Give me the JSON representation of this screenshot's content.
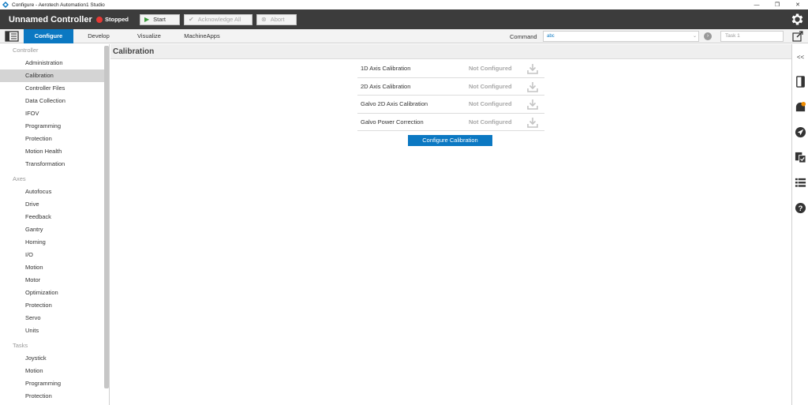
{
  "window": {
    "title": "Configure - Aerotech Automation1 Studio",
    "minimize": "—",
    "restore": "❐",
    "close": "✕"
  },
  "header": {
    "controller_name": "Unnamed Controller",
    "status": "Stopped",
    "status_color": "#e53935",
    "start_label": "Start",
    "acknowledge_label": "Acknowledge All",
    "abort_label": "Abort"
  },
  "nav": {
    "tabs": [
      {
        "label": "Configure",
        "active": true
      },
      {
        "label": "Develop",
        "active": false
      },
      {
        "label": "Visualize",
        "active": false
      },
      {
        "label": "MachineApps",
        "active": false
      }
    ],
    "command_label": "Command",
    "command_value": "abc",
    "task_placeholder": "Task 1"
  },
  "sidebar": {
    "groups": [
      {
        "label": "Controller",
        "items": [
          "Administration",
          "Calibration",
          "Controller Files",
          "Data Collection",
          "IFOV",
          "Programming",
          "Protection",
          "Motion Health",
          "Transformation"
        ]
      },
      {
        "label": "Axes",
        "items": [
          "Autofocus",
          "Drive",
          "Feedback",
          "Gantry",
          "Homing",
          "I/O",
          "Motion",
          "Motor",
          "Optimization",
          "Protection",
          "Servo",
          "Units"
        ]
      },
      {
        "label": "Tasks",
        "items": [
          "Joystick",
          "Motion",
          "Programming",
          "Protection"
        ]
      }
    ],
    "selected": "Calibration"
  },
  "main": {
    "title": "Calibration",
    "rows": [
      {
        "name": "1D Axis Calibration",
        "status": "Not Configured"
      },
      {
        "name": "2D Axis Calibration",
        "status": "Not Configured"
      },
      {
        "name": "Galvo 2D Axis Calibration",
        "status": "Not Configured"
      },
      {
        "name": "Galvo Power Correction",
        "status": "Not Configured"
      }
    ],
    "configure_button": "Configure Calibration"
  },
  "rail": {
    "collapse": "<<"
  },
  "colors": {
    "accent": "#0b78c2",
    "header_bg": "#3c3c3c"
  }
}
